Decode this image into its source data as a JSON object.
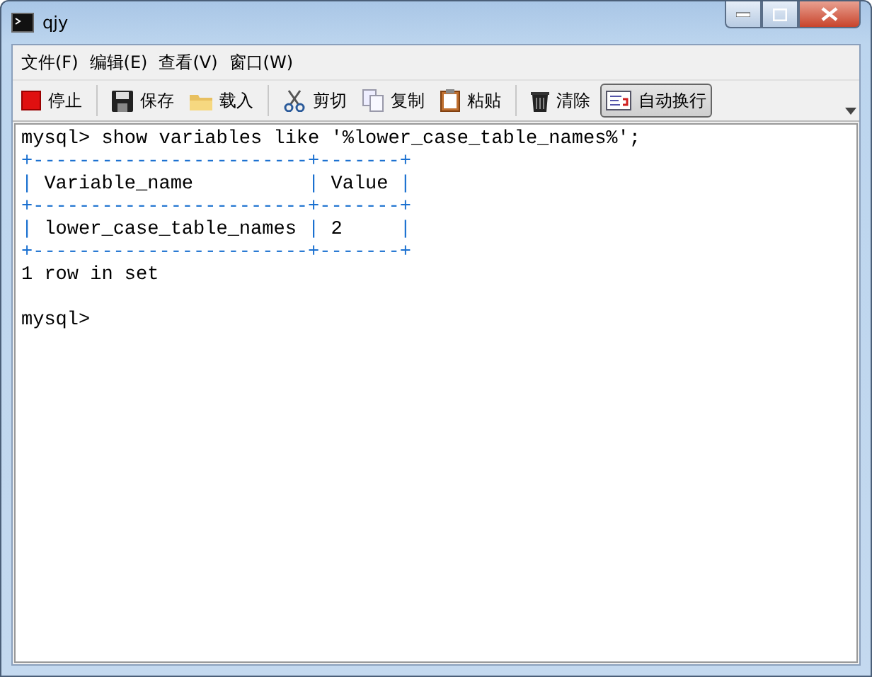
{
  "window": {
    "title": "qjy"
  },
  "menu": [
    "文件(F)",
    "编辑(E)",
    "查看(V)",
    "窗口(W)"
  ],
  "toolbar": [
    {
      "kind": "stop",
      "label": "停止",
      "selected": false
    },
    {
      "kind": "separator"
    },
    {
      "kind": "save",
      "label": "保存",
      "selected": false
    },
    {
      "kind": "load",
      "label": "载入",
      "selected": false
    },
    {
      "kind": "separator"
    },
    {
      "kind": "cut",
      "label": "剪切",
      "selected": false
    },
    {
      "kind": "copy",
      "label": "复制",
      "selected": false
    },
    {
      "kind": "paste",
      "label": "粘贴",
      "selected": false
    },
    {
      "kind": "separator"
    },
    {
      "kind": "clear",
      "label": "清除",
      "selected": false
    },
    {
      "kind": "wrap",
      "label": "自动换行",
      "selected": true
    }
  ],
  "console": [
    [
      {
        "kind": "text",
        "text": "mysql> show variables like '%lower_case_table_names%';"
      }
    ],
    [
      {
        "kind": "border",
        "text": "+------------------------+-------+"
      }
    ],
    [
      {
        "kind": "border",
        "text": "|"
      },
      {
        "kind": "text",
        "text": " Variable_name          "
      },
      {
        "kind": "border",
        "text": "|"
      },
      {
        "kind": "text",
        "text": " Value "
      },
      {
        "kind": "border",
        "text": "|"
      }
    ],
    [
      {
        "kind": "border",
        "text": "+------------------------+-------+"
      }
    ],
    [
      {
        "kind": "border",
        "text": "|"
      },
      {
        "kind": "text",
        "text": " lower_case_table_names "
      },
      {
        "kind": "border",
        "text": "|"
      },
      {
        "kind": "text",
        "text": " 2     "
      },
      {
        "kind": "border",
        "text": "|"
      }
    ],
    [
      {
        "kind": "border",
        "text": "+------------------------+-------+"
      }
    ],
    [
      {
        "kind": "text",
        "text": "1 row in set"
      }
    ],
    [
      {
        "kind": "blank"
      }
    ],
    [
      {
        "kind": "text",
        "text": "mysql>"
      }
    ]
  ]
}
